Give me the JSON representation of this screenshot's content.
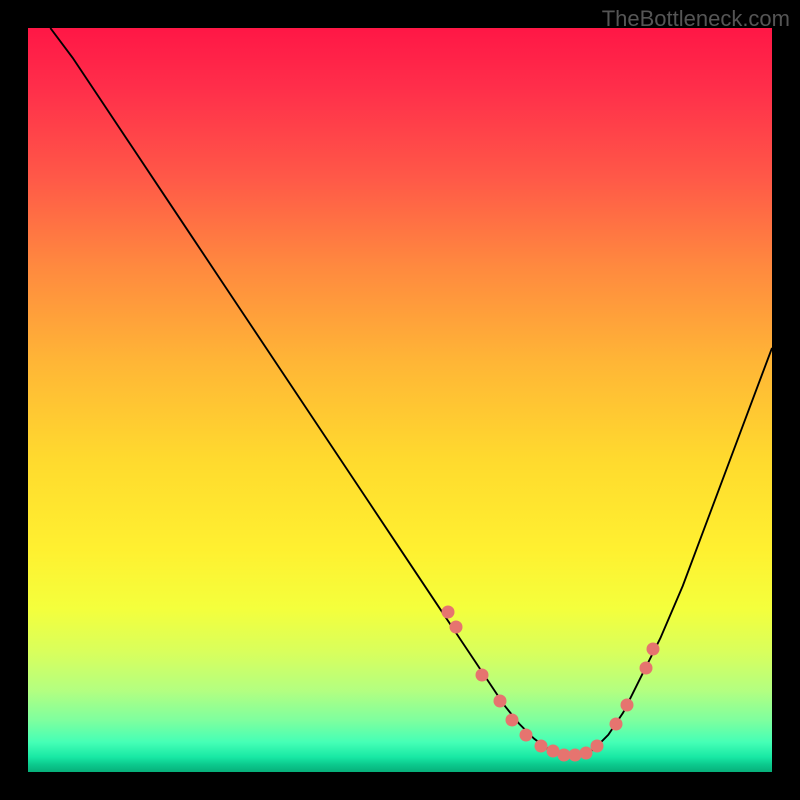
{
  "watermark": "TheBottleneck.com",
  "chart_data": {
    "type": "line",
    "title": "",
    "xlabel": "",
    "ylabel": "",
    "xlim": [
      0,
      100
    ],
    "ylim": [
      0,
      100
    ],
    "grid": false,
    "legend": false,
    "series": [
      {
        "name": "curve",
        "x": [
          3,
          6,
          10,
          14,
          18,
          22,
          26,
          30,
          34,
          38,
          42,
          46,
          50,
          54,
          58,
          60,
          62,
          64,
          66,
          68,
          70,
          72,
          74,
          76,
          78,
          80,
          82,
          85,
          88,
          91,
          94,
          97,
          100
        ],
        "y": [
          100,
          96,
          90,
          84,
          78,
          72,
          66,
          60,
          54,
          48,
          42,
          36,
          30,
          24,
          18,
          15,
          12,
          9,
          6.5,
          4.5,
          3,
          2.2,
          2.2,
          3,
          5,
          8,
          12,
          18,
          25,
          33,
          41,
          49,
          57
        ],
        "color": "#000000"
      }
    ],
    "points": {
      "name": "marked-points",
      "color": "#e6746f",
      "x": [
        56.5,
        57.5,
        61,
        63.5,
        65,
        67,
        69,
        70.5,
        72,
        73.5,
        75,
        76.5,
        79,
        80.5,
        83,
        84
      ],
      "y": [
        21.5,
        19.5,
        13,
        9.5,
        7,
        5,
        3.5,
        2.8,
        2.3,
        2.3,
        2.6,
        3.5,
        6.5,
        9,
        14,
        16.5
      ]
    },
    "background_gradient": {
      "type": "vertical",
      "stops": [
        {
          "pos": 0.0,
          "color": "#ff1746"
        },
        {
          "pos": 0.2,
          "color": "#ff5848"
        },
        {
          "pos": 0.45,
          "color": "#ffb636"
        },
        {
          "pos": 0.7,
          "color": "#fff030"
        },
        {
          "pos": 0.85,
          "color": "#b4ff80"
        },
        {
          "pos": 1.0,
          "color": "#07b07a"
        }
      ]
    }
  }
}
